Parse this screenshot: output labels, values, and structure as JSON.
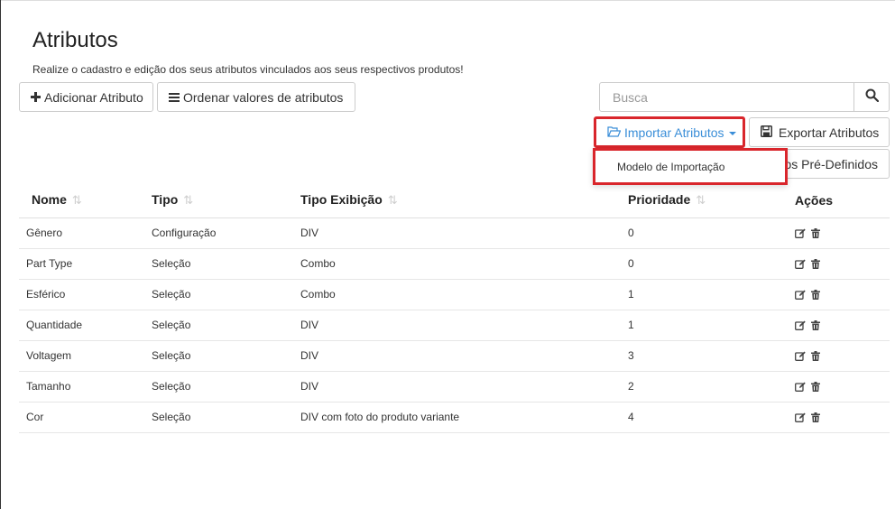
{
  "page": {
    "title": "Atributos",
    "subtitle": "Realize o cadastro e edição dos seus atributos vinculados aos seus respectivos produtos!"
  },
  "toolbar": {
    "add_label": "Adicionar Atributo",
    "order_label": "Ordenar valores de atributos",
    "search_placeholder": "Busca",
    "import_label": "Importar Atributos",
    "export_label": "Exportar Atributos",
    "predefined_label": "os Pré-Definidos"
  },
  "import_menu": {
    "items": [
      "Modelo de Importação"
    ]
  },
  "table": {
    "headers": [
      "Nome",
      "Tipo",
      "Tipo Exibição",
      "Prioridade",
      "Ações"
    ],
    "rows": [
      [
        "Gênero",
        "Configuração",
        "DIV",
        "0"
      ],
      [
        "Part Type",
        "Seleção",
        "Combo",
        "0"
      ],
      [
        "Esférico",
        "Seleção",
        "Combo",
        "1"
      ],
      [
        "Quantidade",
        "Seleção",
        "DIV",
        "1"
      ],
      [
        "Voltagem",
        "Seleção",
        "DIV",
        "3"
      ],
      [
        "Tamanho",
        "Seleção",
        "DIV",
        "2"
      ],
      [
        "Cor",
        "Seleção",
        "DIV com foto do produto variante",
        "4"
      ]
    ]
  },
  "icons": {
    "add": "plus-icon",
    "order": "list-icon",
    "search": "search-icon",
    "import": "folder-open-icon",
    "export": "floppy-icon",
    "edit": "edit-icon",
    "delete": "trash-icon",
    "sort": "sort-icon"
  },
  "colors": {
    "highlight": "#d9262c",
    "link": "#3a8ed8"
  }
}
